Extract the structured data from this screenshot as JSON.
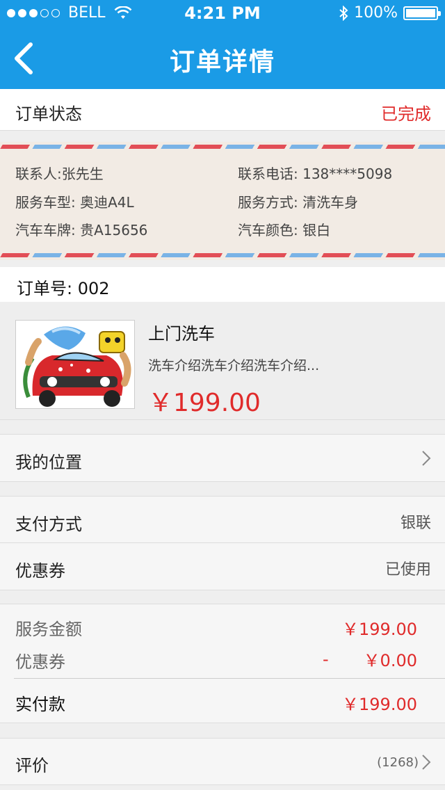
{
  "status_bar": {
    "carrier": "BELL",
    "time": "4:21 PM",
    "battery": "100%"
  },
  "nav": {
    "title": "订单详情"
  },
  "order_status": {
    "label": "订单状态",
    "value": "已完成"
  },
  "contact": {
    "name": "联系人:张先生",
    "phone": "联系电话: 138****5098",
    "car_model": "服务车型: 奥迪A4L",
    "service_type": "服务方式: 清洗车身",
    "plate": "汽车车牌: 贵A15656",
    "color": "汽车颜色: 银白"
  },
  "order_no": "订单号: 002",
  "product": {
    "title": "上门洗车",
    "desc": "洗车介绍洗车介绍洗车介绍...",
    "price": "￥199.00"
  },
  "location": {
    "label": "我的位置"
  },
  "payment": {
    "method_label": "支付方式",
    "method_value": "银联",
    "coupon_label": "优惠券",
    "coupon_value": "已使用"
  },
  "summary": {
    "service_amount_label": "服务金额",
    "service_amount": "￥199.00",
    "coupon_label": "优惠券",
    "coupon_minus": "-",
    "coupon_amount": "￥0.00",
    "paid_label": "实付款",
    "paid_amount": "￥199.00"
  },
  "review": {
    "label": "评价",
    "count": "(1268)"
  },
  "colors": {
    "primary": "#1a9be6",
    "price": "#e02b2b"
  }
}
